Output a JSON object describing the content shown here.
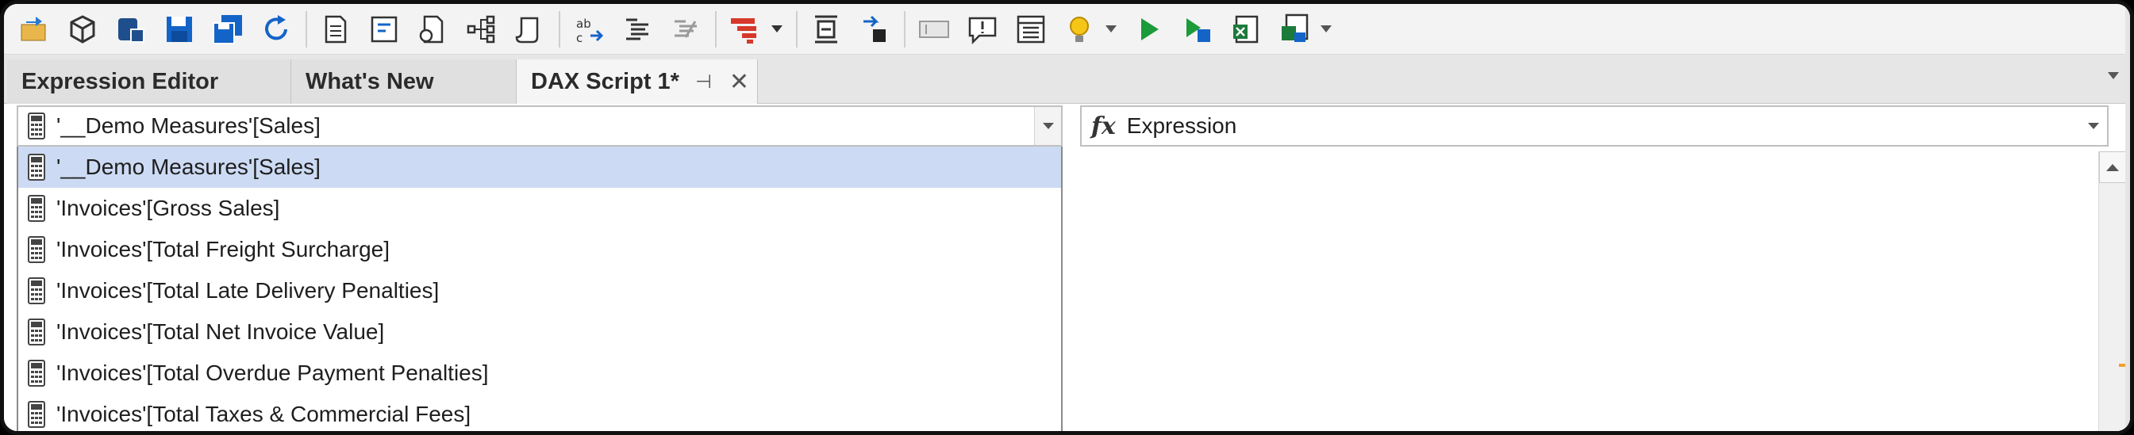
{
  "toolbar": {
    "icons": [
      "open-folder-icon",
      "model-cube-icon",
      "deploy-icon",
      "save-icon",
      "save-all-icon",
      "refresh-icon",
      "document-icon",
      "properties-icon",
      "script-icon",
      "tree-icon",
      "advanced-icon",
      "replace-icon",
      "format-icon",
      "comment-icon",
      "hierarchy-red-icon",
      "insert-icon",
      "arrow-cell-icon",
      "textbox-icon",
      "comment-bubble-icon",
      "checklist-icon",
      "lightbulb-icon",
      "run-icon",
      "run-selection-icon",
      "export-icon",
      "export-all-icon"
    ]
  },
  "tabs": [
    {
      "label": "Expression Editor"
    },
    {
      "label": "What's New"
    },
    {
      "label": "DAX Script 1*",
      "pin": "⊣",
      "close": "✕"
    }
  ],
  "object_selector": {
    "value": "'__Demo Measures'[Sales]"
  },
  "property_selector": {
    "fx": "fx",
    "value": "Expression"
  },
  "dropdown": {
    "items": [
      {
        "label": "'__Demo Measures'[Sales]",
        "selected": true
      },
      {
        "label": "'Invoices'[Gross Sales]"
      },
      {
        "label": "'Invoices'[Total Freight Surcharge]"
      },
      {
        "label": "'Invoices'[Total Late Delivery Penalties]"
      },
      {
        "label": "'Invoices'[Total Net Invoice Value]"
      },
      {
        "label": "'Invoices'[Total Overdue Payment Penalties]"
      },
      {
        "label": "'Invoices'[Total Taxes & Commercial Fees]"
      }
    ]
  },
  "colors": {
    "selection": "#ccdaf3",
    "accent_blue": "#1464c8",
    "marker": "#f0a030"
  }
}
